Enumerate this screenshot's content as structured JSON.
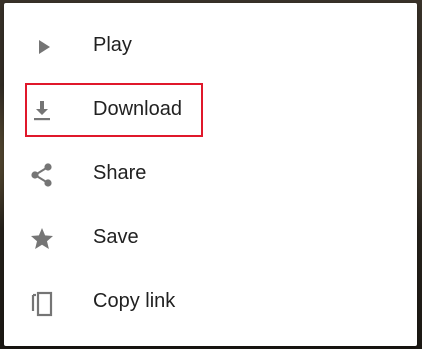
{
  "menu": {
    "items": [
      {
        "label": "Play",
        "icon": "play-icon"
      },
      {
        "label": "Download",
        "icon": "download-icon"
      },
      {
        "label": "Share",
        "icon": "share-icon"
      },
      {
        "label": "Save",
        "icon": "star-icon"
      },
      {
        "label": "Copy link",
        "icon": "copy-icon"
      }
    ],
    "highlighted_item": "Download"
  },
  "colors": {
    "icon": "#757575",
    "text": "#212121",
    "highlight": "#e0182b",
    "menu_background": "#ffffff"
  }
}
